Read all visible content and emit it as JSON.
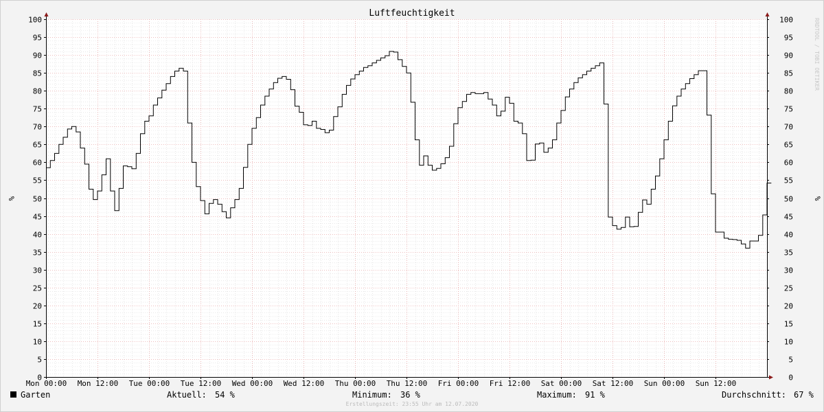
{
  "chart_data": {
    "type": "line",
    "title": "Luftfeuchtigkeit",
    "ylabel": "%",
    "ylim": [
      0,
      100
    ],
    "yticks": [
      0,
      5,
      10,
      15,
      20,
      25,
      30,
      35,
      40,
      45,
      50,
      55,
      60,
      65,
      70,
      75,
      80,
      85,
      90,
      95,
      100
    ],
    "xlim": [
      "Mon 00:00",
      "Sun 23:55"
    ],
    "xtick_labels": [
      "Mon 00:00",
      "Mon 12:00",
      "Tue 00:00",
      "Tue 12:00",
      "Wed 00:00",
      "Wed 12:00",
      "Thu 00:00",
      "Thu 12:00",
      "Fri 00:00",
      "Fri 12:00",
      "Sat 00:00",
      "Sat 12:00",
      "Sun 00:00",
      "Sun 12:00"
    ],
    "grid": true,
    "series": [
      {
        "name": "Garten",
        "x_hours": [
          0,
          1,
          2,
          3,
          4,
          5,
          6,
          7,
          8,
          9,
          10,
          11,
          12,
          13,
          14,
          15,
          16,
          17,
          18,
          19,
          20,
          21,
          22,
          23,
          24,
          25,
          26,
          27,
          28,
          29,
          30,
          31,
          32,
          33,
          34,
          35,
          36,
          37,
          38,
          39,
          40,
          41,
          42,
          43,
          44,
          45,
          46,
          47,
          48,
          49,
          50,
          51,
          52,
          53,
          54,
          55,
          56,
          57,
          58,
          59,
          60,
          61,
          62,
          63,
          64,
          65,
          66,
          67,
          68,
          69,
          70,
          71,
          72,
          73,
          74,
          75,
          76,
          77,
          78,
          79,
          80,
          81,
          82,
          83,
          84,
          85,
          86,
          87,
          88,
          89,
          90,
          91,
          92,
          93,
          94,
          95,
          96,
          97,
          98,
          99,
          100,
          101,
          102,
          103,
          104,
          105,
          106,
          107,
          108,
          109,
          110,
          111,
          112,
          113,
          114,
          115,
          116,
          117,
          118,
          119,
          120,
          121,
          122,
          123,
          124,
          125,
          126,
          127,
          128,
          129,
          130,
          131,
          132,
          133,
          134,
          135,
          136,
          137,
          138,
          139,
          140,
          141,
          142,
          143,
          144,
          145,
          146,
          147,
          148,
          149,
          150,
          151,
          152,
          153,
          154,
          155,
          156,
          157,
          158,
          159,
          160,
          161,
          162,
          163,
          164,
          165,
          166,
          167,
          168
        ],
        "values": [
          58.5,
          60.5,
          62.5,
          65,
          67,
          69.3,
          70,
          68.5,
          64,
          59.5,
          52.5,
          49.6,
          52,
          56.5,
          61,
          52,
          46.5,
          52.7,
          59,
          58.8,
          58.2,
          62.5,
          68,
          71.5,
          73,
          76,
          78,
          80.2,
          82,
          84,
          85.5,
          86.3,
          85.5,
          71,
          60,
          53.2,
          49.3,
          45.6,
          48.5,
          49.6,
          48.3,
          46.2,
          44.5,
          47.3,
          49.6,
          52.7,
          58.6,
          65,
          69.5,
          72.5,
          76,
          78.5,
          80.5,
          82.3,
          83.5,
          84,
          83.2,
          80.3,
          75.7,
          74,
          70.5,
          70.3,
          71.5,
          69.5,
          69.2,
          68.3,
          69,
          72.8,
          75.5,
          79,
          81.5,
          83.3,
          84.5,
          85.5,
          86.5,
          87,
          87.8,
          88.5,
          89.2,
          89.8,
          91,
          90.8,
          88.7,
          86.8,
          85,
          76.8,
          66.3,
          59.2,
          61.8,
          59.2,
          57.8,
          58.3,
          59.6,
          61.3,
          64.5,
          70.8,
          75.3,
          77,
          79,
          79.5,
          79.2,
          79.2,
          79.5,
          77.7,
          76,
          73,
          74.3,
          78.2,
          76.5,
          71.5,
          71,
          68,
          60.5,
          60.6,
          65.1,
          65.4,
          62.8,
          64,
          66.3,
          71,
          74.5,
          78.3,
          80.5,
          82.3,
          83.6,
          84.5,
          85.5,
          86.3,
          87,
          87.8,
          76.3,
          44.7,
          42.3,
          41.3,
          41.8,
          44.7,
          42,
          42.1,
          46,
          49.5,
          48.3,
          52.5,
          56.2,
          61,
          66.3,
          71.5,
          75.8,
          78.5,
          80.5,
          82,
          83.4,
          84.5,
          85.6,
          85.6,
          73.2,
          51.2,
          40.5,
          40.5,
          38.8,
          38.5,
          38.4,
          38.2,
          37.2,
          36,
          38,
          38,
          39.6,
          45.3,
          54.2,
          54.2
        ]
      }
    ]
  },
  "legend": {
    "series_label": "Garten",
    "series_color": "#000000",
    "current_label": "Aktuell:",
    "current_value": "54 %",
    "min_label": "Minimum:",
    "min_value": "36 %",
    "max_label": "Maximum:",
    "max_value": "91 %",
    "avg_label": "Durchschnitt:",
    "avg_value": "67 %"
  },
  "footer": "Erstellungszeit: 23:55 Uhr am 12.07.2020",
  "watermark": "RRDTOOL / TOBI OETIKER",
  "colors": {
    "background": "#f3f3f3",
    "plot": "#ffffff",
    "grid_minor": "#d9d9d9",
    "grid_major": "#e7a6a6",
    "arrow": "#8b1a1a",
    "line": "#000000"
  }
}
